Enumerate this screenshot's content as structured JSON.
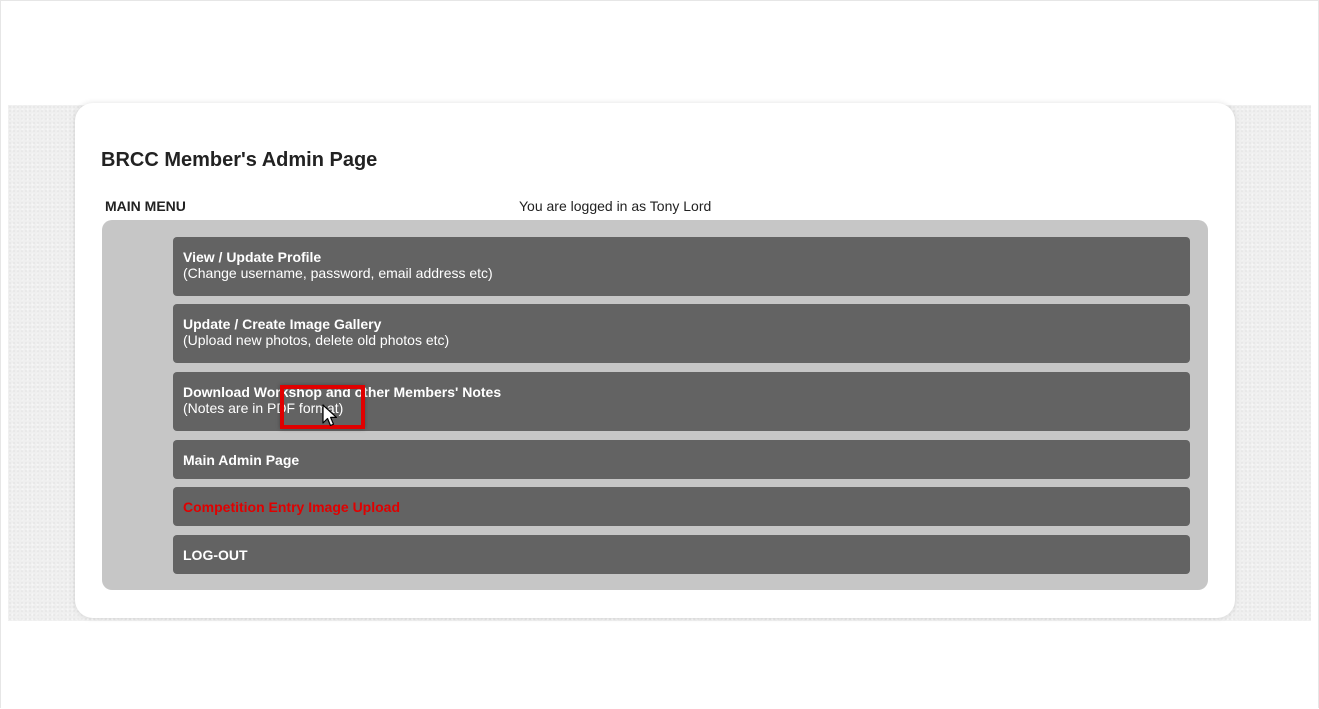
{
  "page": {
    "title": "BRCC Member's Admin Page",
    "menu_heading": "MAIN MENU",
    "login_status": "You are logged in as Tony Lord"
  },
  "menu": {
    "items": [
      {
        "title": "View / Update Profile",
        "description": "(Change username, password, email address etc)"
      },
      {
        "title": "Update / Create Image Gallery",
        "description": "(Upload new photos, delete old photos etc)"
      },
      {
        "title": "Download Workshop and other Members' Notes",
        "description": "(Notes are in PDF format)"
      },
      {
        "title": "Main Admin Page",
        "description": ""
      },
      {
        "title": "Competition Entry Image Upload",
        "description": ""
      },
      {
        "title": "LOG-OUT",
        "description": ""
      }
    ]
  },
  "colors": {
    "menu_item_bg": "#636363",
    "menu_panel_bg": "#c6c6c6",
    "highlight": "#e00000"
  },
  "icons": {
    "cursor": "mouse-pointer-icon"
  }
}
